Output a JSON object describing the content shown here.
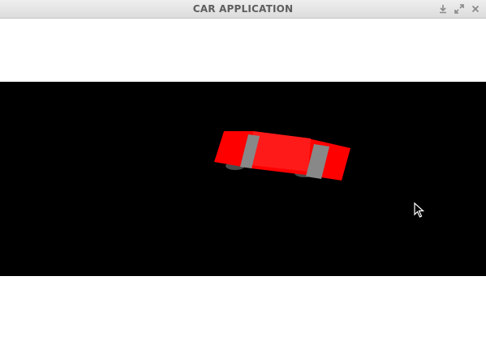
{
  "window": {
    "title": "CAR APPLICATION",
    "controls": [
      "minimize",
      "maximize",
      "close"
    ]
  },
  "scene": {
    "background": "#000000",
    "car_body_color": "#ff0000",
    "car_stripe_color": "#888888",
    "wheel_color": "#4a4a4a"
  },
  "colors": {
    "titlebar": "#e2e2e2",
    "title_text": "#5e5e5e",
    "client": "#ffffff"
  }
}
